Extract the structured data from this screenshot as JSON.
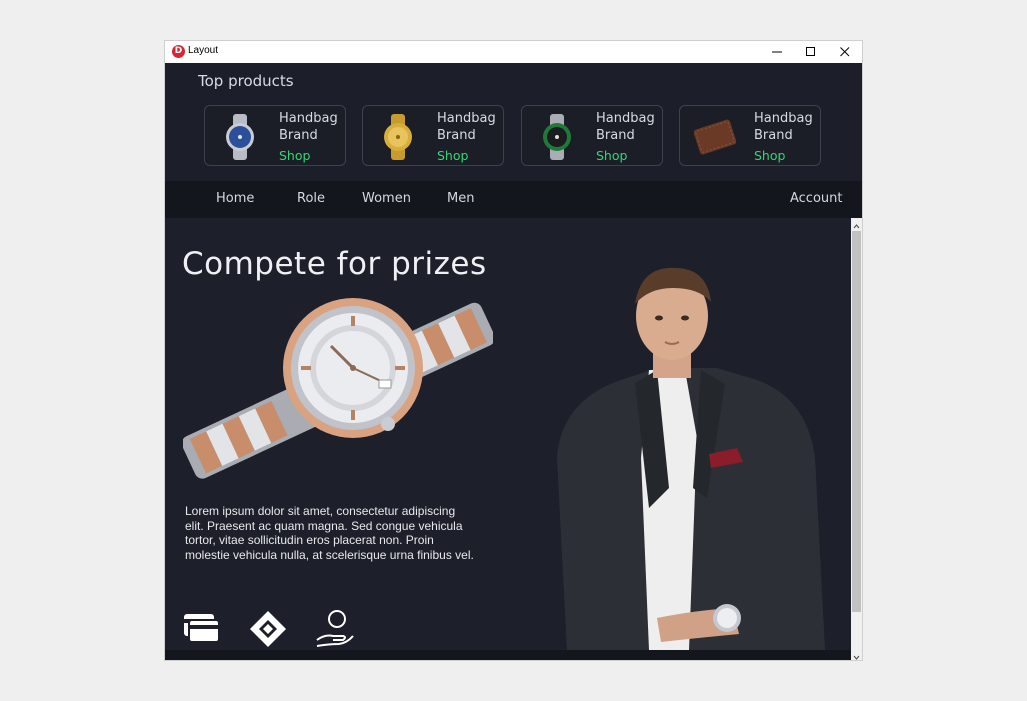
{
  "window": {
    "title": "Layout",
    "icon_letter": "D"
  },
  "top_products": {
    "title": "Top products",
    "items": [
      {
        "title": "Handbag Brand",
        "action": "Shop",
        "image": "blue-dial-watch"
      },
      {
        "title": "Handbag Brand",
        "action": "Shop",
        "image": "gold-watch"
      },
      {
        "title": "Handbag Brand",
        "action": "Shop",
        "image": "green-bezel-watch"
      },
      {
        "title": "Handbag Brand",
        "action": "Shop",
        "image": "brown-leather-wallet"
      }
    ]
  },
  "nav": {
    "items": [
      "Home",
      "Role",
      "Women",
      "Men"
    ],
    "account": "Account"
  },
  "hero": {
    "title": "Compete for prizes",
    "body": "Lorem ipsum dolor sit amet, consectetur adipiscing elit. Praesent ac quam magna. Sed congue vehicula tortor, vitae sollicitudin eros placerat non. Proin molestie vehicula nulla, at scelerisque urna finibus vel.",
    "feature_icons": [
      "cards-icon",
      "diamond-icon",
      "hand-user-icon"
    ]
  },
  "colors": {
    "background": "#1d202a",
    "nav": "#14161d",
    "accent_green": "#2ed872",
    "text": "#d9dbe2"
  }
}
